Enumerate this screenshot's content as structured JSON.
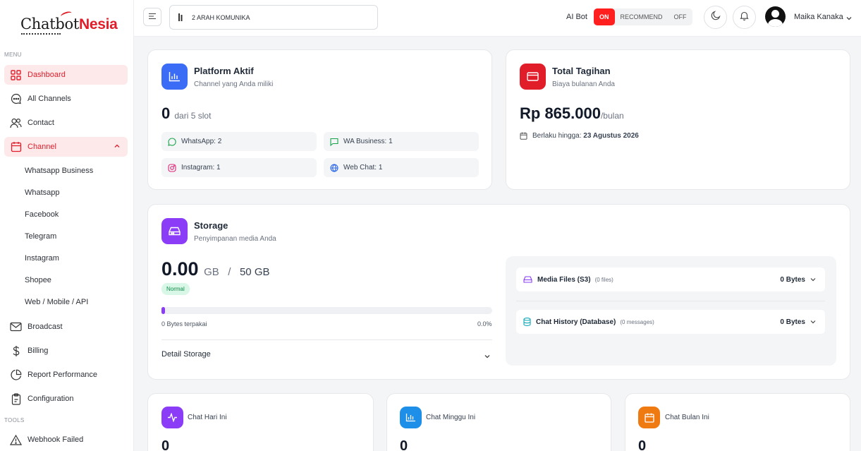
{
  "brand": {
    "logo_part1": "Chatbot",
    "logo_part2": "Nesia"
  },
  "sidebar": {
    "menu_label": "MENU",
    "tools_label": "TOOLS",
    "items": [
      {
        "label": "Dashboard"
      },
      {
        "label": "All Channels"
      },
      {
        "label": "Contact"
      },
      {
        "label": "Channel"
      },
      {
        "label": "Broadcast"
      },
      {
        "label": "Billing"
      },
      {
        "label": "Report Performance"
      },
      {
        "label": "Configuration"
      },
      {
        "label": "Webhook Failed"
      }
    ],
    "channel_sub": [
      "Whatsapp Business",
      "Whatsapp",
      "Facebook",
      "Telegram",
      "Instagram",
      "Shopee",
      "Web / Mobile / API"
    ]
  },
  "topbar": {
    "workspace": "2 ARAH KOMUNIKA",
    "ai_bot_label": "AI Bot",
    "toggle": {
      "on": "ON",
      "recommend": "RECOMMEND",
      "off": "OFF",
      "selected": "ON"
    },
    "user_name": "Maika Kanaka"
  },
  "platform": {
    "title": "Platform Aktif",
    "subtitle": "Channel yang Anda miliki",
    "count": "0",
    "slot_text": "dari 5 slot",
    "channels": [
      "WhatsApp: 2",
      "WA Business: 1",
      "Instagram: 1",
      "Web Chat: 1"
    ]
  },
  "billing": {
    "title": "Total Tagihan",
    "subtitle": "Biaya bulanan Anda",
    "amount": "Rp 865.000",
    "period": "/bulan",
    "valid_label": "Berlaku hingga:",
    "valid_date": "23 Agustus 2026"
  },
  "storage": {
    "title": "Storage",
    "subtitle": "Penyimpanan media Anda",
    "used": "0.00",
    "used_unit": "GB",
    "separator": "/",
    "total": "50 GB",
    "status": "Normal",
    "used_label": "0 Bytes terpakai",
    "percent": "0.0%",
    "usage_fraction": 0.0,
    "detail_label": "Detail Storage",
    "rows": [
      {
        "name": "Media Files (S3)",
        "meta": "(0 files)",
        "value": "0 Bytes"
      },
      {
        "name": "Chat History (Database)",
        "meta": "(0 messages)",
        "value": "0 Bytes"
      }
    ]
  },
  "stats": [
    {
      "title": "Chat Hari Ini",
      "value": "0",
      "color": "#8b3cf6"
    },
    {
      "title": "Chat Minggu Ini",
      "value": "0",
      "color": "#1d8fe8"
    },
    {
      "title": "Chat Bulan Ini",
      "value": "0",
      "color": "#f07a12"
    }
  ],
  "colors": {
    "accent": "#e11d2a",
    "toggle_on": "#ff1f1f",
    "platform_icon": "#3b6cf6",
    "billing_icon": "#e11d2a",
    "storage_icon": "#8b3cf6"
  }
}
